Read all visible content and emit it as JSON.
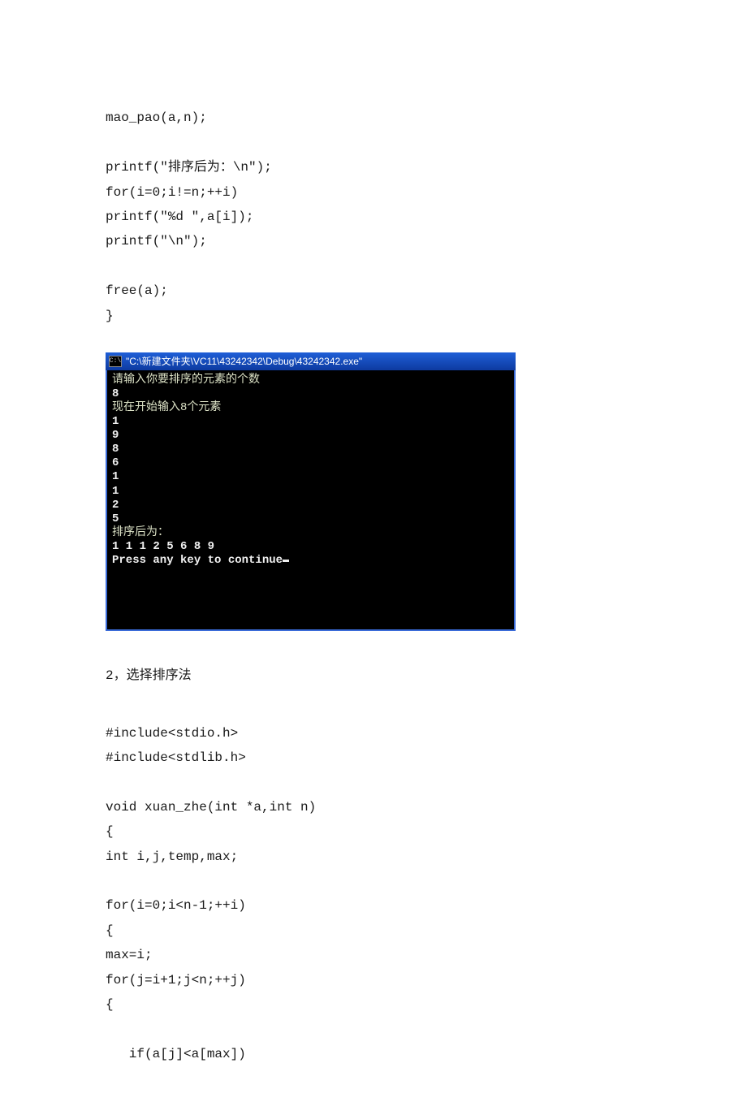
{
  "code_top": {
    "l1": "mao_pao(a,n);",
    "l2": "",
    "l3": "printf(\"排序后为：\\n\");",
    "l4": "for(i=0;i!=n;++i)",
    "l5": "printf(\"%d \",a[i]);",
    "l6": "printf(\"\\n\");",
    "l7": "",
    "l8": "free(a);",
    "l9": "}"
  },
  "console": {
    "title": "\"C:\\新建文件夹\\VC11\\43242342\\Debug\\43242342.exe\"",
    "line_prompt1": "请输入你要排序的元素的个数",
    "line_n": "8",
    "line_prompt2": "现在开始输入8个元素",
    "inputs": [
      "1",
      "9",
      "8",
      "6",
      "1",
      "1",
      "2",
      "5"
    ],
    "line_sorted_label": "排序后为：",
    "line_sorted_vals": "1 1 1 2 5 6 8 9",
    "line_press": "Press any key to continue"
  },
  "section2_title": "2，选择排序法",
  "code_bottom": {
    "l1": "#include<stdio.h>",
    "l2": "#include<stdlib.h>",
    "l3": "",
    "l4": "void xuan_zhe(int *a,int n)",
    "l5": "{",
    "l6": "int i,j,temp,max;",
    "l7": "",
    "l8": "for(i=0;i<n-1;++i)",
    "l9": "{",
    "l10": "max=i;",
    "l11": "for(j=i+1;j<n;++j)",
    "l12": "{",
    "l13": "",
    "l14": "   if(a[j]<a[max])"
  }
}
